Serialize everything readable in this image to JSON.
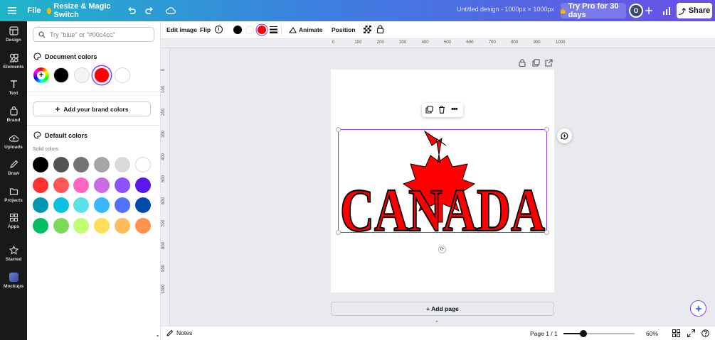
{
  "topbar": {
    "file_label": "File",
    "resize_label": "Resize & Magic Switch",
    "doc_title": "Untitled design - 1000px × 1000px",
    "try_pro_label": "Try Pro for 30 days",
    "avatar_initial": "O",
    "share_label": "Share"
  },
  "rail": {
    "items": [
      "Design",
      "Elements",
      "Text",
      "Brand",
      "Uploads",
      "Draw",
      "Projects",
      "Apps",
      "Starred",
      "Mockups"
    ]
  },
  "panel": {
    "search_placeholder": "Try \"blue\" or \"#00c4cc\"",
    "document_colors_title": "Document colors",
    "document_colors": [
      "#000000",
      "#f4f4f4",
      "#ff0000",
      "#ffffff"
    ],
    "add_brand_label": "Add your brand colors",
    "default_colors_title": "Default colors",
    "solid_colors_label": "Solid colors",
    "solid_colors": [
      [
        "#000000",
        "#545454",
        "#737373",
        "#a6a6a6",
        "#d9d9d9",
        "#ffffff"
      ],
      [
        "#ff3131",
        "#ff5757",
        "#ff66c4",
        "#cb6ce6",
        "#8c52ff",
        "#5e17eb"
      ],
      [
        "#0097b2",
        "#0cc0df",
        "#5ce1e6",
        "#38b6ff",
        "#5271ff",
        "#004aad"
      ],
      [
        "#00bf63",
        "#7ed957",
        "#c1ff72",
        "#ffde59",
        "#ffbd59",
        "#ff914d"
      ]
    ]
  },
  "context": {
    "edit_image": "Edit image",
    "flip": "Flip",
    "colors": [
      "#000000",
      "#ffffff",
      "#ff0000"
    ],
    "animate": "Animate",
    "position": "Position"
  },
  "ruler": {
    "h_ticks": [
      "0",
      "100",
      "200",
      "300",
      "400",
      "500",
      "600",
      "700",
      "800",
      "900",
      "1000"
    ],
    "v_ticks": [
      "0",
      "100",
      "200",
      "300",
      "400",
      "500",
      "600",
      "700",
      "800",
      "900",
      "1000"
    ]
  },
  "canvas": {
    "artwork_text": "CANADA",
    "add_page_label": "+ Add page"
  },
  "bottom": {
    "notes_label": "Notes",
    "page_indicator": "Page 1 / 1",
    "zoom_percent": 60,
    "zoom_label": "60%"
  }
}
